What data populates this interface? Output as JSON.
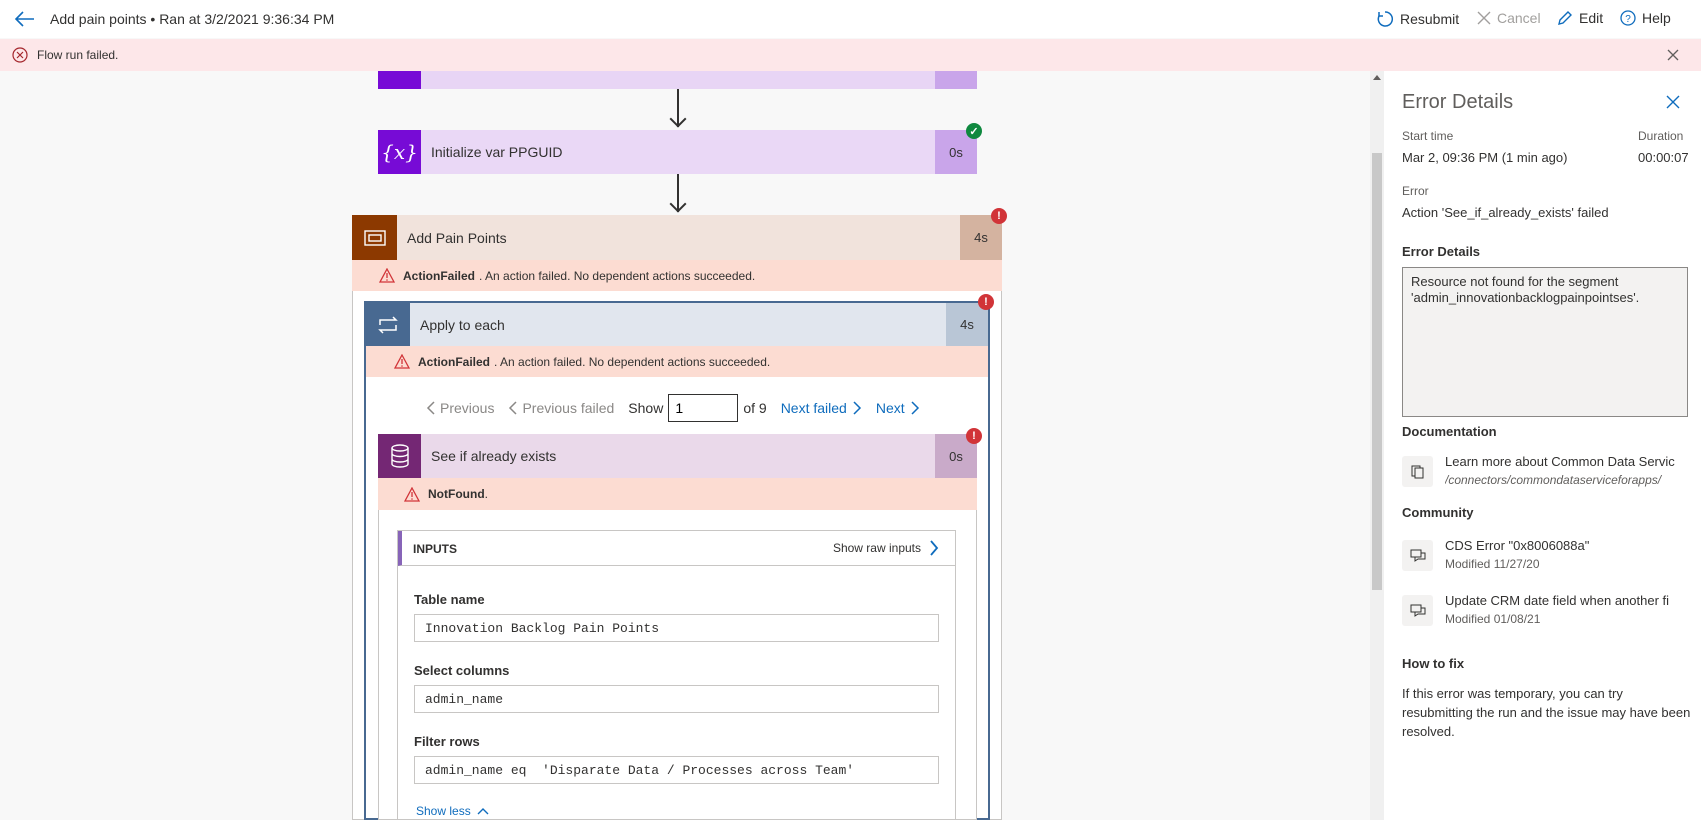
{
  "header": {
    "title": "Add pain points • Ran at 3/2/2021 9:36:34 PM",
    "resubmit": "Resubmit",
    "cancel": "Cancel",
    "edit": "Edit",
    "help": "Help"
  },
  "banner": {
    "text": "Flow run failed."
  },
  "flow": {
    "init_var": {
      "title": "Initialize var PPGUID",
      "duration": "0s"
    },
    "scope": {
      "title": "Add Pain Points",
      "duration": "4s",
      "error_code": "ActionFailed",
      "error_text": ". An action failed. No dependent actions succeeded."
    },
    "apply": {
      "title": "Apply to each",
      "duration": "4s",
      "error_code": "ActionFailed",
      "error_text": ". An action failed. No dependent actions succeeded.",
      "pager": {
        "previous": "Previous",
        "previous_failed": "Previous failed",
        "show": "Show",
        "current": "1",
        "of": "of 9",
        "next_failed": "Next failed",
        "next": "Next"
      }
    },
    "action": {
      "title": "See if already exists",
      "duration": "0s",
      "error_code": "NotFound",
      "error_suffix": ".",
      "inputs": {
        "label": "INPUTS",
        "show_raw": "Show raw inputs",
        "fields": [
          {
            "label": "Table name",
            "value": "Innovation Backlog Pain Points"
          },
          {
            "label": "Select columns",
            "value": "admin_name"
          },
          {
            "label": "Filter rows",
            "value": "admin_name eq  'Disparate Data / Processes across Team'"
          }
        ],
        "show_less": "Show less"
      }
    }
  },
  "panel": {
    "title": "Error Details",
    "start_label": "Start time",
    "start_value": "Mar 2, 09:36 PM (1 min ago)",
    "duration_label": "Duration",
    "duration_value": "00:00:07",
    "error_label": "Error",
    "error_value": "Action 'See_if_already_exists' failed",
    "details_label": "Error Details",
    "details_text": "Resource not found for the segment 'admin_innovationbacklogpainpointses'.",
    "documentation_label": "Documentation",
    "doc": {
      "title": "Learn more about Common Data Servic",
      "sub": "/connectors/commondataserviceforapps/"
    },
    "community_label": "Community",
    "community": [
      {
        "title": "CDS Error \"0x8006088a\"",
        "sub": "Modified 11/27/20"
      },
      {
        "title": "Update CRM date field when another fi",
        "sub": "Modified 01/08/21"
      }
    ],
    "howfix_label": "How to fix",
    "howfix_text": "If this error was temporary, you can try resubmitting the run and the issue may have been resolved."
  },
  "colors": {
    "variable_purple": "#770bd6",
    "scope_brown": "#8c3900",
    "loop_blue": "#486991",
    "dataverse_purple": "#742774",
    "error_red": "#d13438",
    "link_blue": "#0f6cbd"
  }
}
